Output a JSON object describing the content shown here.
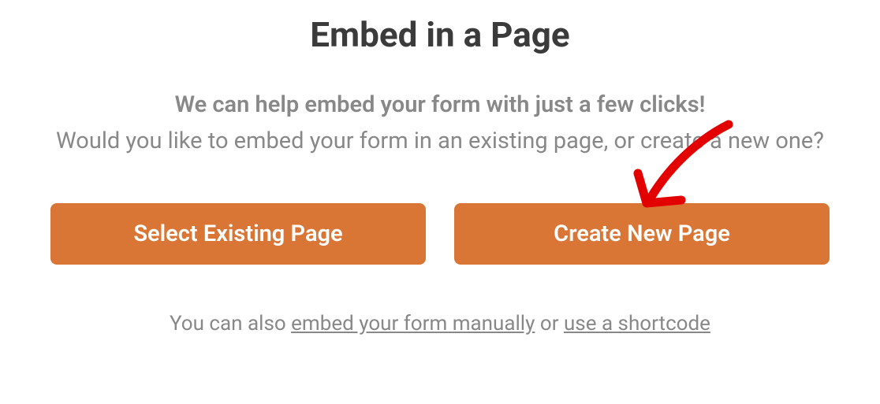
{
  "heading": "Embed in a Page",
  "subtitle": "We can help embed your form with just a few clicks!",
  "description": "Would you like to embed your form in an existing page, or create a new one?",
  "buttons": {
    "select_existing": "Select Existing Page",
    "create_new": "Create New Page"
  },
  "footer": {
    "prefix": "You can also ",
    "link_manual": "embed your form manually",
    "middle": " or ",
    "link_shortcode": "use a shortcode"
  },
  "annotation": {
    "arrow_color": "#e20000"
  }
}
